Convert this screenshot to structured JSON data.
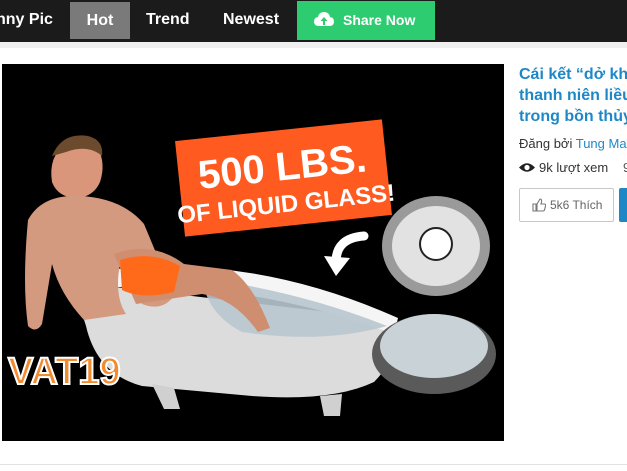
{
  "nav": {
    "items": [
      {
        "label": "nny Pic"
      },
      {
        "label": "Hot",
        "active": true
      },
      {
        "label": "Trend"
      },
      {
        "label": "Newest"
      }
    ],
    "share": {
      "label": "Share Now",
      "icon": "cloud-upload-icon",
      "color": "#2ecc71"
    },
    "background": "#1b1b1b",
    "active_background": "#7a7a7a"
  },
  "media": {
    "banner_line1": "500 LBS.",
    "banner_line2": "OF LIQUID GLASS!",
    "logo_text": "VAT19"
  },
  "post": {
    "title_lines": [
      "Cái kết “dở kh",
      "thanh niên liều",
      "trong bồn thủy"
    ],
    "posted_by_label": "Đăng bởi",
    "author": "Tung Man",
    "views": "9k lượt xem",
    "views_extra": "9",
    "like_label": "5k6 Thích",
    "accent": "#1e88c7"
  }
}
